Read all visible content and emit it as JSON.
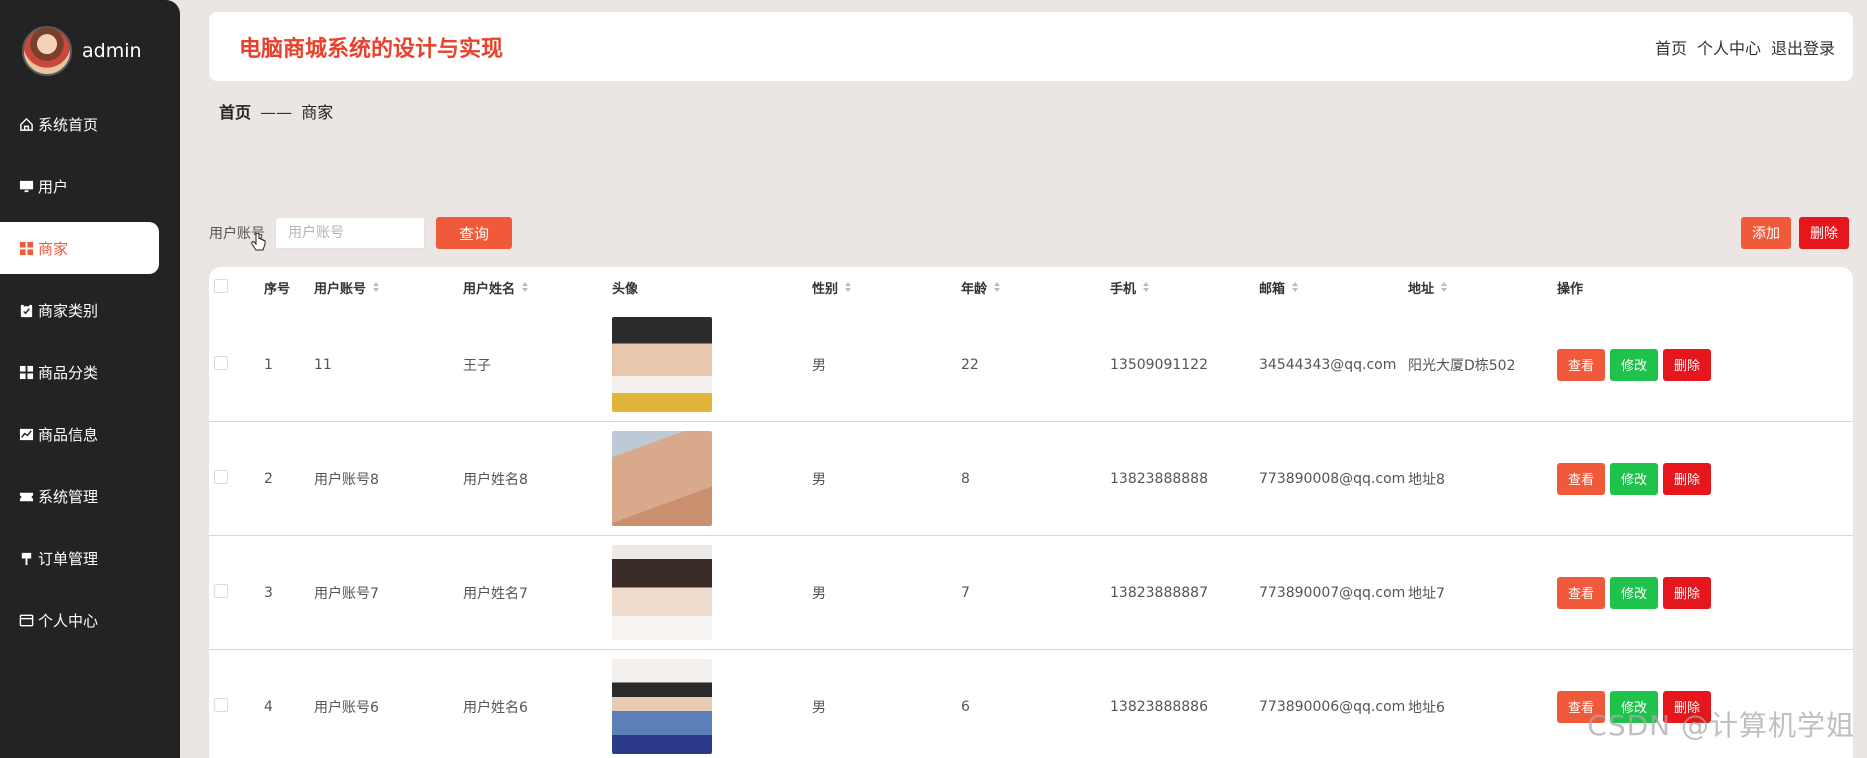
{
  "user": {
    "name": "admin"
  },
  "sidebar": {
    "items": [
      {
        "label": "系统首页",
        "icon": "home-icon"
      },
      {
        "label": "用户",
        "icon": "monitor-icon"
      },
      {
        "label": "商家",
        "icon": "grid-icon",
        "active": true
      },
      {
        "label": "商家类别",
        "icon": "clipboard-icon"
      },
      {
        "label": "商品分类",
        "icon": "grid-icon"
      },
      {
        "label": "商品信息",
        "icon": "chart-icon"
      },
      {
        "label": "系统管理",
        "icon": "ticket-icon"
      },
      {
        "label": "订单管理",
        "icon": "pin-icon"
      },
      {
        "label": "个人中心",
        "icon": "card-icon"
      }
    ]
  },
  "header": {
    "title": "电脑商城系统的设计与实现",
    "links": [
      "首页",
      "个人中心",
      "退出登录"
    ]
  },
  "breadcrumb": {
    "home": "首页",
    "separator": "——",
    "current": "商家"
  },
  "search": {
    "label": "用户账号",
    "placeholder": "用户账号",
    "button": "查询"
  },
  "toolbar": {
    "add": "添加",
    "delete": "删除"
  },
  "table": {
    "headers": [
      "序号",
      "用户账号",
      "用户姓名",
      "头像",
      "性别",
      "年龄",
      "手机",
      "邮箱",
      "地址",
      "操作"
    ],
    "rows": [
      {
        "index": "1",
        "account": "11",
        "name": "王子",
        "gender": "男",
        "age": "22",
        "phone": "13509091122",
        "email": "34544343@qq.com",
        "address": "阳光大厦D栋502"
      },
      {
        "index": "2",
        "account": "用户账号8",
        "name": "用户姓名8",
        "gender": "男",
        "age": "8",
        "phone": "13823888888",
        "email": "773890008@qq.com",
        "address": "地址8"
      },
      {
        "index": "3",
        "account": "用户账号7",
        "name": "用户姓名7",
        "gender": "男",
        "age": "7",
        "phone": "13823888887",
        "email": "773890007@qq.com",
        "address": "地址7"
      },
      {
        "index": "4",
        "account": "用户账号6",
        "name": "用户姓名6",
        "gender": "男",
        "age": "6",
        "phone": "13823888886",
        "email": "773890006@qq.com",
        "address": "地址6"
      }
    ],
    "actions": {
      "view": "查看",
      "edit": "修改",
      "delete": "删除"
    }
  },
  "watermark": "CSDN @计算机学姐",
  "colors": {
    "accent": "#f05a3b",
    "danger": "#e6161d",
    "success": "#1fc24a",
    "sidebar": "#232323"
  }
}
